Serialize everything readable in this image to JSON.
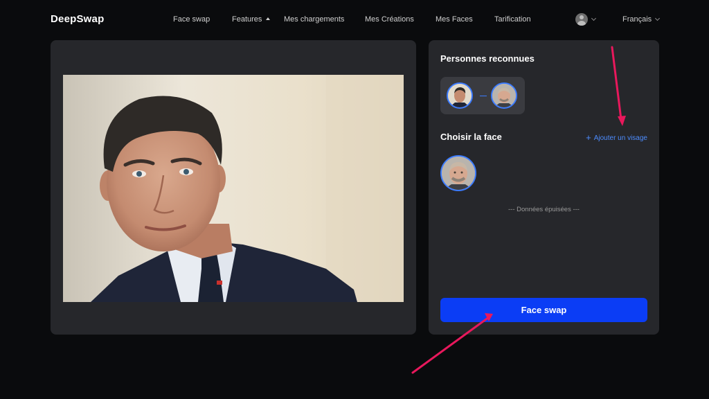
{
  "header": {
    "logo": "DeepSwap",
    "nav": [
      {
        "label": "Face swap"
      },
      {
        "label": "Features"
      },
      {
        "label": "Mes chargements"
      },
      {
        "label": "Mes Créations"
      },
      {
        "label": "Mes Faces"
      },
      {
        "label": "Tarification"
      }
    ],
    "language": "Français",
    "avatar_icon": "user-avatar-icon"
  },
  "right_panel": {
    "recognized_title": "Personnes reconnues",
    "choose_title": "Choisir la face",
    "add_face_label": "Ajouter un visage",
    "exhausted_text": "--- Données épuisées ---",
    "swap_button": "Face swap"
  },
  "colors": {
    "background": "#0a0b0d",
    "panel": "#26272b",
    "accent_blue": "#0b3df5",
    "link_blue": "#4d8dff",
    "annotation_arrow": "#e8185c"
  }
}
